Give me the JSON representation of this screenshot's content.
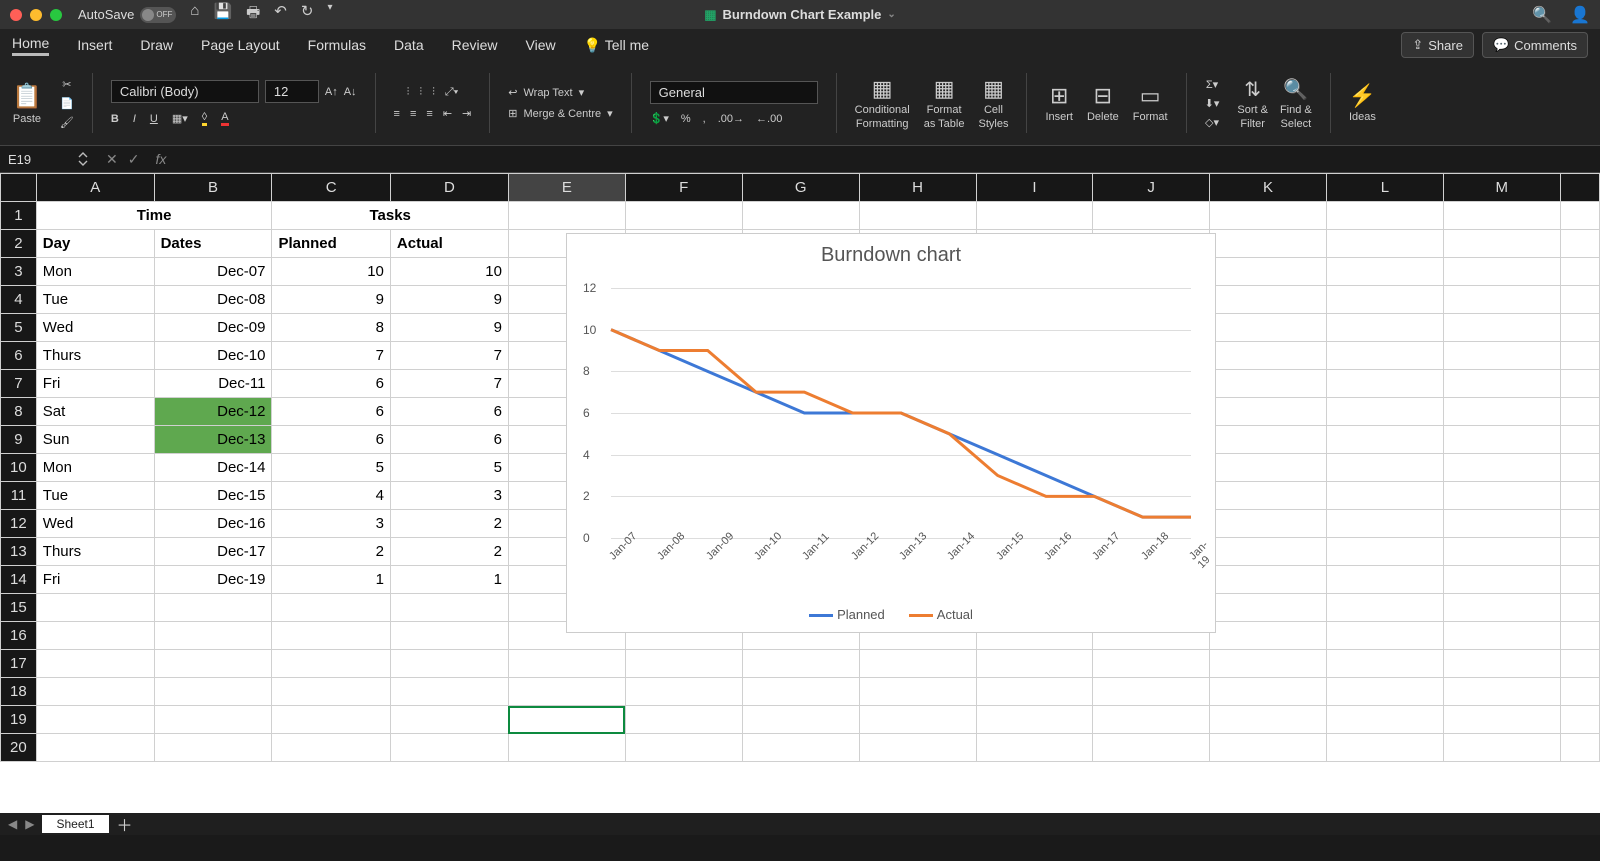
{
  "window": {
    "autosave_label": "AutoSave",
    "autosave_state": "OFF",
    "filename": "Burndown Chart Example"
  },
  "tabs": {
    "items": [
      "Home",
      "Insert",
      "Draw",
      "Page Layout",
      "Formulas",
      "Data",
      "Review",
      "View"
    ],
    "tell_me": "Tell me",
    "share": "Share",
    "comments": "Comments"
  },
  "ribbon": {
    "paste": "Paste",
    "font_name": "Calibri (Body)",
    "font_size": "12",
    "wrap": "Wrap Text",
    "merge": "Merge & Centre",
    "number_format": "General",
    "cond": "Conditional",
    "cond2": "Formatting",
    "fmt1": "Format",
    "fmt2": "as Table",
    "cell1": "Cell",
    "cell2": "Styles",
    "insert": "Insert",
    "delete": "Delete",
    "format": "Format",
    "sort1": "Sort &",
    "sort2": "Filter",
    "find1": "Find &",
    "find2": "Select",
    "ideas": "Ideas"
  },
  "fbar": {
    "cell": "E19"
  },
  "columns": [
    "",
    "A",
    "B",
    "C",
    "D",
    "E",
    "F",
    "G",
    "H",
    "I",
    "J",
    "K",
    "L",
    "M"
  ],
  "sheet": {
    "h1": {
      "time": "Time",
      "tasks": "Tasks"
    },
    "h2": {
      "day": "Day",
      "dates": "Dates",
      "planned": "Planned",
      "actual": "Actual"
    },
    "rows": [
      {
        "n": 3,
        "day": "Mon",
        "date": "Dec-07",
        "p": 10,
        "a": 10
      },
      {
        "n": 4,
        "day": "Tue",
        "date": "Dec-08",
        "p": 9,
        "a": 9
      },
      {
        "n": 5,
        "day": "Wed",
        "date": "Dec-09",
        "p": 8,
        "a": 9
      },
      {
        "n": 6,
        "day": "Thurs",
        "date": "Dec-10",
        "p": 7,
        "a": 7
      },
      {
        "n": 7,
        "day": "Fri",
        "date": "Dec-11",
        "p": 6,
        "a": 7
      },
      {
        "n": 8,
        "day": "Sat",
        "date": "Dec-12",
        "p": 6,
        "a": 6,
        "green": true
      },
      {
        "n": 9,
        "day": "Sun",
        "date": "Dec-13",
        "p": 6,
        "a": 6,
        "green": true
      },
      {
        "n": 10,
        "day": "Mon",
        "date": "Dec-14",
        "p": 5,
        "a": 5
      },
      {
        "n": 11,
        "day": "Tue",
        "date": "Dec-15",
        "p": 4,
        "a": 3
      },
      {
        "n": 12,
        "day": "Wed",
        "date": "Dec-16",
        "p": 3,
        "a": 2
      },
      {
        "n": 13,
        "day": "Thurs",
        "date": "Dec-17",
        "p": 2,
        "a": 2
      },
      {
        "n": 14,
        "day": "Fri",
        "date": "Dec-19",
        "p": 1,
        "a": 1
      }
    ],
    "empty": [
      15,
      16,
      17,
      18,
      19,
      20
    ],
    "selected_row": 19
  },
  "status": {
    "sheet": "Sheet1"
  },
  "chart_data": {
    "type": "line",
    "title": "Burndown chart",
    "xlabel": "",
    "ylabel": "",
    "ylim": [
      0,
      12
    ],
    "yticks": [
      0,
      2,
      4,
      6,
      8,
      10,
      12
    ],
    "categories": [
      "Jan-07",
      "Jan-08",
      "Jan-09",
      "Jan-10",
      "Jan-11",
      "Jan-12",
      "Jan-13",
      "Jan-14",
      "Jan-15",
      "Jan-16",
      "Jan-17",
      "Jan-18",
      "Jan-19"
    ],
    "series": [
      {
        "name": "Planned",
        "color": "#3d78d6",
        "values": [
          10,
          9,
          8,
          7,
          6,
          6,
          6,
          5,
          4,
          3,
          2,
          1,
          1
        ]
      },
      {
        "name": "Actual",
        "color": "#ed7d31",
        "values": [
          10,
          9,
          9,
          7,
          7,
          6,
          6,
          5,
          3,
          2,
          2,
          1,
          1
        ]
      }
    ]
  }
}
